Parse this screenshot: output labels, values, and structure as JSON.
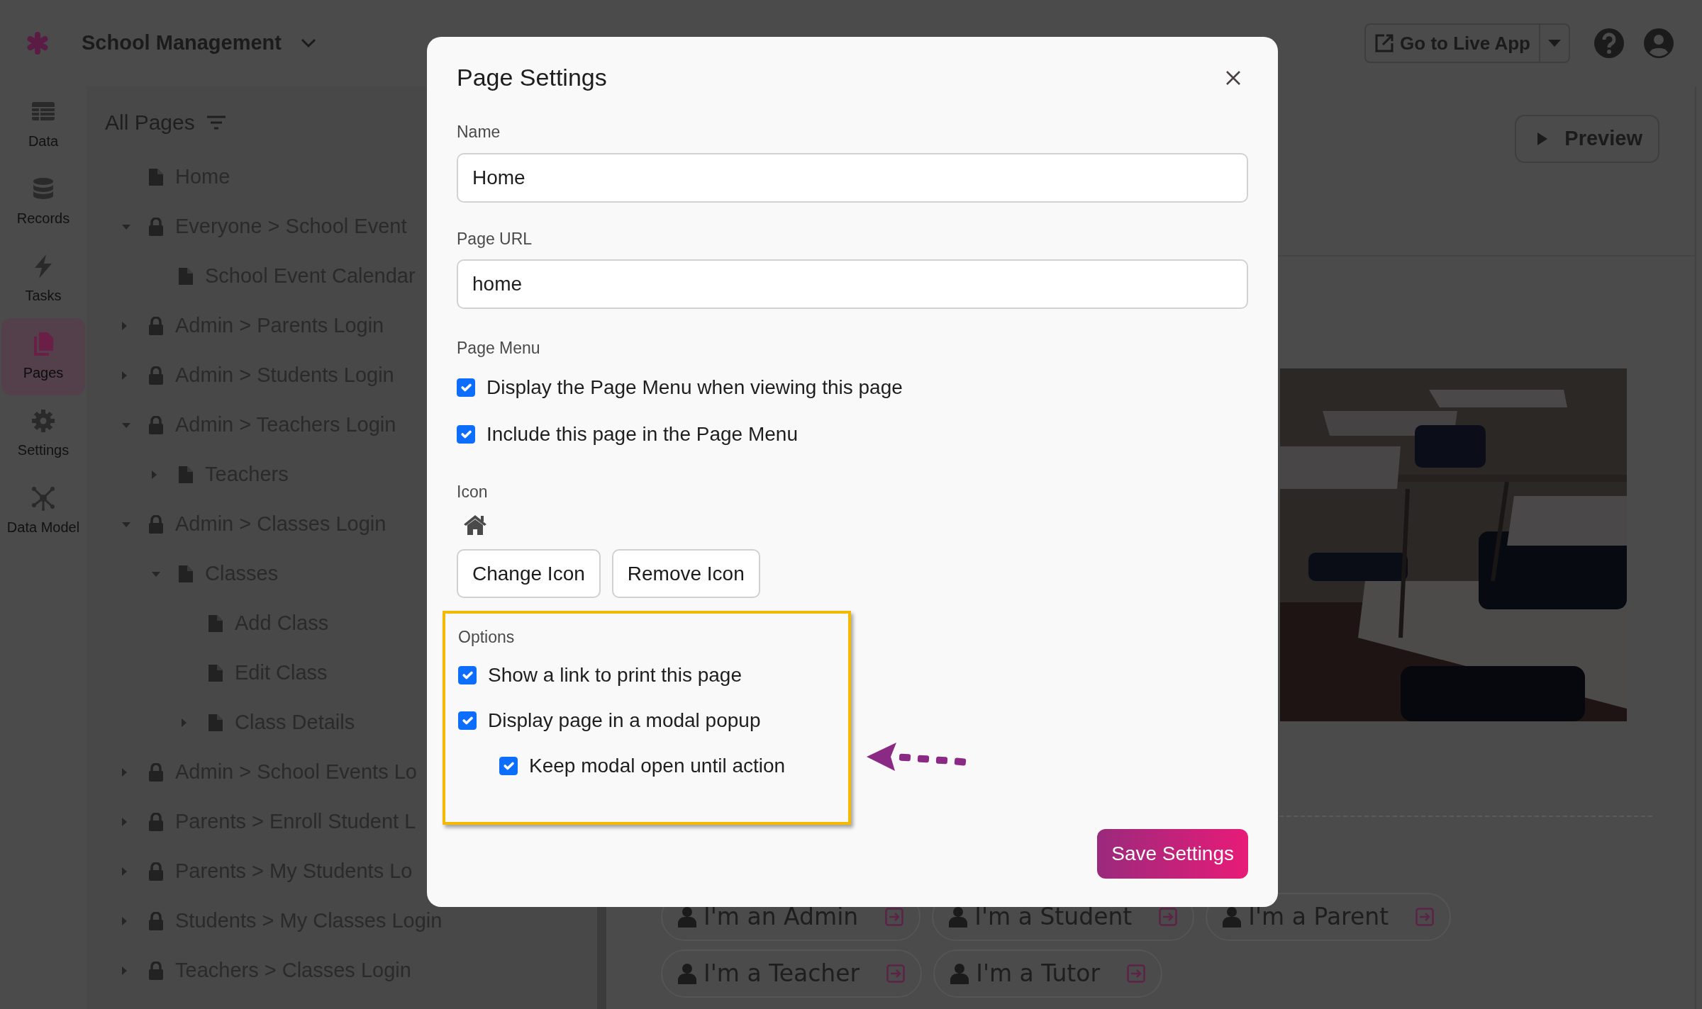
{
  "app": {
    "title": "School Management"
  },
  "nav": [
    {
      "label": "Data",
      "selected": false
    },
    {
      "label": "Records",
      "selected": false
    },
    {
      "label": "Tasks",
      "selected": false
    },
    {
      "label": "Pages",
      "selected": true
    },
    {
      "label": "Settings",
      "selected": false
    },
    {
      "label": "Data Model",
      "selected": false
    }
  ],
  "pages_panel": {
    "title": "All Pages",
    "tree": [
      {
        "kind": "page",
        "label": "Home"
      },
      {
        "kind": "login",
        "label": "Everyone > School Event",
        "expanded": true,
        "children": [
          {
            "kind": "page",
            "label": "School Event Calendar"
          }
        ]
      },
      {
        "kind": "login",
        "label": "Admin > Parents Login",
        "expanded": false
      },
      {
        "kind": "login",
        "label": "Admin > Students Login",
        "expanded": false
      },
      {
        "kind": "login",
        "label": "Admin > Teachers Login",
        "expanded": true,
        "children": [
          {
            "kind": "page",
            "label": "Teachers",
            "expanded": false
          }
        ]
      },
      {
        "kind": "login",
        "label": "Admin > Classes Login",
        "expanded": true,
        "children": [
          {
            "kind": "page",
            "label": "Classes",
            "expanded": true,
            "children": [
              {
                "kind": "page",
                "label": "Add Class"
              },
              {
                "kind": "page",
                "label": "Edit Class"
              },
              {
                "kind": "page",
                "label": "Class Details",
                "expanded": false
              }
            ]
          }
        ]
      },
      {
        "kind": "login",
        "label": "Admin > School Events Lo",
        "expanded": false
      },
      {
        "kind": "login",
        "label": "Parents > Enroll Student L",
        "expanded": false
      },
      {
        "kind": "login",
        "label": "Parents > My Students Lo",
        "expanded": false
      },
      {
        "kind": "login",
        "label": "Students > My Classes Login",
        "expanded": false
      },
      {
        "kind": "login",
        "label": "Teachers > Classes Login",
        "expanded": false
      }
    ]
  },
  "header": {
    "live_app_button": "Go to Live App",
    "preview_button": "Preview"
  },
  "content": {
    "picture": {
      "kind": "picture"
    },
    "login_buttons": [
      "I'm an Admin",
      "I'm a Student",
      "I'm a Parent",
      "I'm a Teacher",
      "I'm a Tutor"
    ]
  },
  "modal": {
    "title": "Page Settings",
    "fields": [
      {
        "label": "Name",
        "value": "Home"
      },
      {
        "label": "Page URL",
        "value": "home"
      }
    ],
    "page_menu": {
      "label": "Page Menu",
      "options": [
        {
          "label": "Display the Page Menu when viewing this page",
          "checked": true
        },
        {
          "label": "Include this page in the Page Menu",
          "checked": true
        }
      ]
    },
    "icon": {
      "label": "Icon",
      "buttons": [
        "Change Icon",
        "Remove Icon"
      ]
    },
    "options": {
      "label": "Options",
      "items": [
        {
          "label": "Show a link to print this page",
          "checked": true
        },
        {
          "label": "Display page in a modal popup",
          "checked": true,
          "children": [
            {
              "label": "Keep modal open until action",
              "checked": true
            }
          ]
        }
      ]
    },
    "save_button": "Save Settings"
  }
}
